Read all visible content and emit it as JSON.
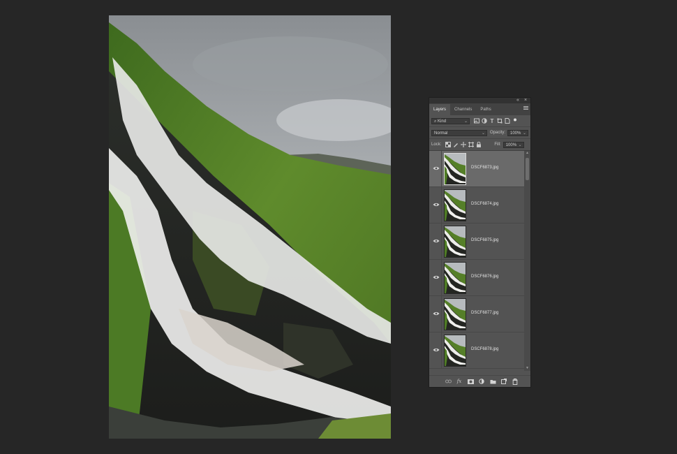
{
  "document": {
    "image": "waterfall-photo"
  },
  "panel": {
    "header_icons": {
      "collapse": "«",
      "close": "×"
    },
    "tabs": [
      {
        "label": "Layers",
        "active": true
      },
      {
        "label": "Channels",
        "active": false
      },
      {
        "label": "Paths",
        "active": false
      }
    ],
    "filter": {
      "kind_label": "Kind",
      "icons": [
        "pixel-filter-icon",
        "adjustment-filter-icon",
        "type-filter-icon",
        "shape-filter-icon",
        "smart-object-filter-icon"
      ]
    },
    "blend_mode": "Normal",
    "opacity_label": "Opacity:",
    "opacity_value": "100%",
    "lock_label": "Lock:",
    "fill_label": "Fill:",
    "fill_value": "100%",
    "layers": [
      {
        "name": "DSCF6873.jpg",
        "visible": true,
        "selected": true
      },
      {
        "name": "DSCF6874.jpg",
        "visible": true,
        "selected": false
      },
      {
        "name": "DSCF6875.jpg",
        "visible": true,
        "selected": false
      },
      {
        "name": "DSCF6876.jpg",
        "visible": true,
        "selected": false
      },
      {
        "name": "DSCF6877.jpg",
        "visible": true,
        "selected": false
      },
      {
        "name": "DSCF6878.jpg",
        "visible": true,
        "selected": false
      }
    ],
    "footer_buttons": [
      "link-layers-icon",
      "fx-icon",
      "mask-icon",
      "adjustment-layer-icon",
      "group-folder-icon",
      "new-layer-icon",
      "trash-icon"
    ],
    "footer_fx_label": "fx",
    "colors": {
      "panel_bg": "#535353",
      "selected_row": "#6a6a6a",
      "app_bg": "#262626"
    }
  }
}
